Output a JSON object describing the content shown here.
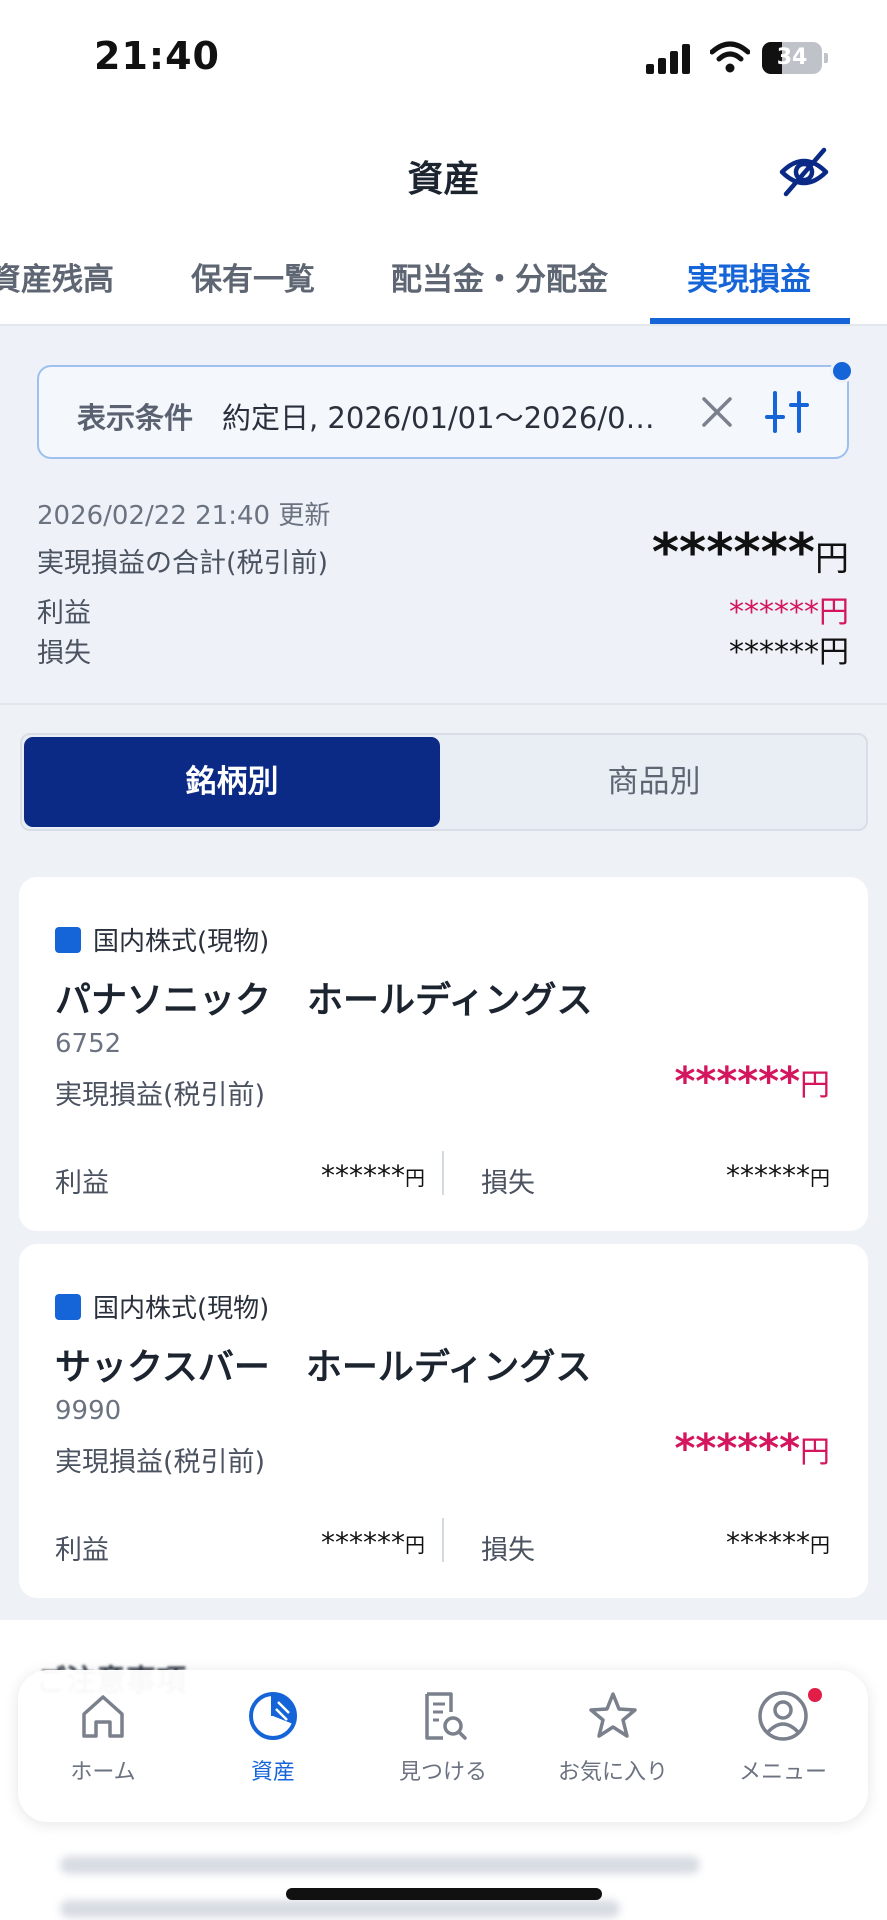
{
  "status_bar": {
    "time": "21:40",
    "battery": "34",
    "battery_level": 0.34
  },
  "header": {
    "title": "資産",
    "hide_icon": "eye-slash-icon"
  },
  "tabs": [
    {
      "label": "資産残高"
    },
    {
      "label": "保有一覧"
    },
    {
      "label": "配当金・分配金"
    },
    {
      "label": "実現損益",
      "active": true
    }
  ],
  "conditions": {
    "label": "表示条件",
    "text": "約定日, 2026/01/01〜2026/0…",
    "clear_icon": "close-icon",
    "filter_icon": "sliders-icon"
  },
  "summary": {
    "updated": "2026/02/22 21:40 更新",
    "total_label": "実現損益の合計(税引前)",
    "total_value": "******",
    "currency": "円",
    "profit_label": "利益",
    "profit_value": "******",
    "loss_label": "損失",
    "loss_value": "******"
  },
  "segment": {
    "active": "銘柄別",
    "inactive": "商品別"
  },
  "cards": [
    {
      "category": "国内株式(現物)",
      "name": "パナソニック　ホールディングス",
      "code": "6752",
      "pl_label": "実現損益(税引前)",
      "pl_value": "******",
      "currency": "円",
      "profit_label": "利益",
      "profit_value": "******",
      "loss_label": "損失",
      "loss_value": "******"
    },
    {
      "category": "国内株式(現物)",
      "name": "サックスバー　ホールディングス",
      "code": "9990",
      "pl_label": "実現損益(税引前)",
      "pl_value": "******",
      "currency": "円",
      "profit_label": "利益",
      "profit_value": "******",
      "loss_label": "損失",
      "loss_value": "******"
    }
  ],
  "notes": {
    "title": "ご注意事項"
  },
  "bottom_nav": [
    {
      "label": "ホーム",
      "icon": "home-icon"
    },
    {
      "label": "資産",
      "icon": "pie-chart-icon",
      "active": true
    },
    {
      "label": "見つける",
      "icon": "document-search-icon"
    },
    {
      "label": "お気に入り",
      "icon": "star-icon"
    },
    {
      "label": "メニュー",
      "icon": "user-circle-icon",
      "badge": true
    }
  ],
  "colors": {
    "accent": "#1565d8",
    "navy": "#0a2a86",
    "profit": "#d3165d",
    "background": "#eef1f6"
  }
}
